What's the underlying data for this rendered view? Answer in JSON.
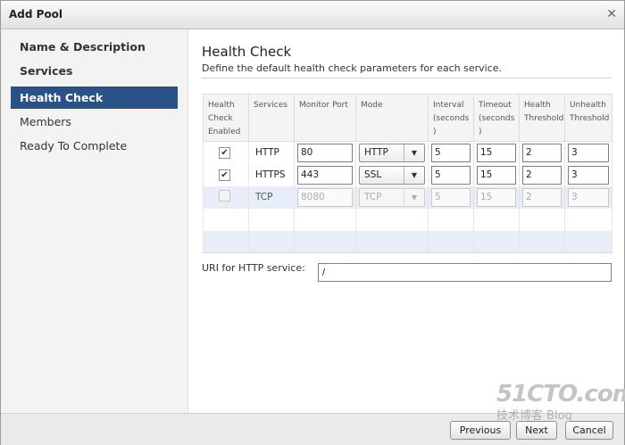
{
  "dialog": {
    "title": "Add Pool",
    "close_glyph": "✕"
  },
  "sidebar": {
    "items": [
      {
        "label": "Name & Description"
      },
      {
        "label": "Services"
      },
      {
        "label": "Health Check"
      },
      {
        "label": "Members"
      },
      {
        "label": "Ready To Complete"
      }
    ]
  },
  "main": {
    "title": "Health Check",
    "subtitle": "Define the default health check parameters for each service.",
    "table": {
      "headers": [
        "Health Check Enabled",
        "Services",
        "Monitor Port",
        "Mode",
        "Interval (seconds )",
        "Timeout (seconds )",
        "Health Threshold",
        "Unhealth Threshold"
      ],
      "rows": [
        {
          "enabled": "✔",
          "service": "HTTP",
          "port": "80",
          "mode": "HTTP",
          "interval": "5",
          "timeout": "15",
          "health": "2",
          "unhealth": "3"
        },
        {
          "enabled": "✔",
          "service": "HTTPS",
          "port": "443",
          "mode": "SSL",
          "interval": "5",
          "timeout": "15",
          "health": "2",
          "unhealth": "3"
        },
        {
          "enabled": "",
          "service": "TCP",
          "port": "8080",
          "mode": "TCP",
          "interval": "5",
          "timeout": "15",
          "health": "2",
          "unhealth": "3"
        }
      ]
    },
    "uri": {
      "label": "URI for HTTP service:",
      "value": "/"
    }
  },
  "footer": {
    "previous": "Previous",
    "next": "Next",
    "cancel": "Cancel"
  },
  "watermark": {
    "main": "51CTO.com",
    "sub": "技术博客 Blog"
  },
  "colors": {
    "nav_active": "#2a5286",
    "row_alt": "#e8eef8"
  }
}
